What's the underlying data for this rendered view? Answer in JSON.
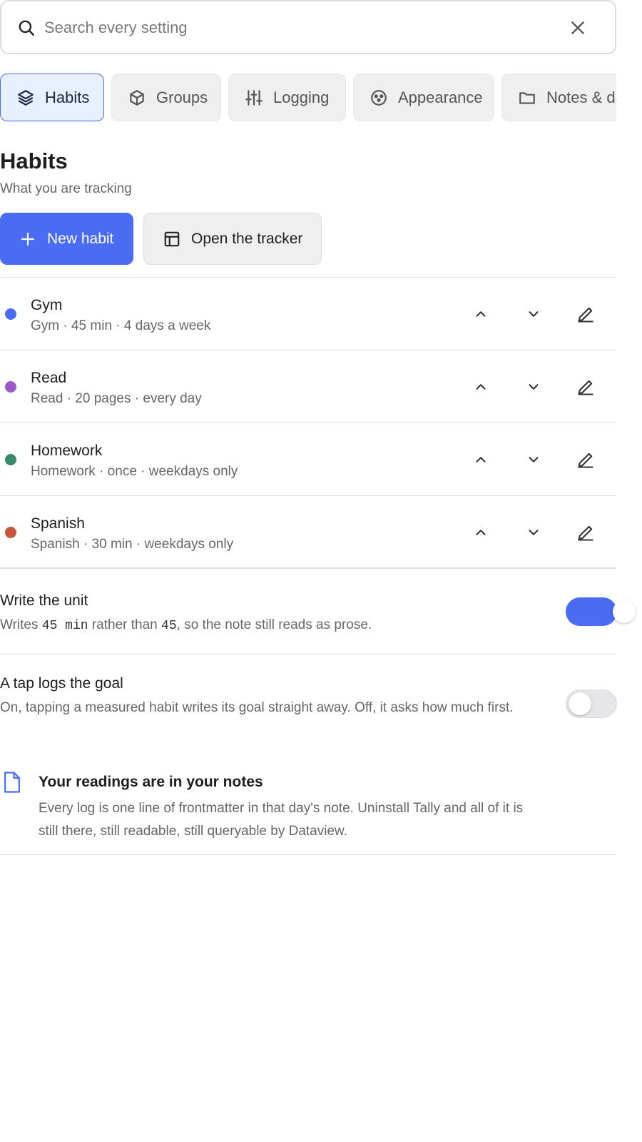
{
  "search": {
    "placeholder": "Search every setting"
  },
  "tabs": [
    {
      "label": "Habits",
      "icon": "layers-icon",
      "active": true
    },
    {
      "label": "Groups",
      "icon": "box-icon",
      "active": false
    },
    {
      "label": "Logging",
      "icon": "sliders-icon",
      "active": false
    },
    {
      "label": "Appearance",
      "icon": "palette-icon",
      "active": false
    },
    {
      "label": "Notes & da",
      "icon": "folder-icon",
      "active": false
    }
  ],
  "section": {
    "title": "Habits",
    "subtitle": "What you are tracking"
  },
  "actions": {
    "new_habit": "New habit",
    "open_tracker": "Open the tracker"
  },
  "habits": [
    {
      "name": "Gym",
      "desc": "Gym · 45 min · 4 days a week",
      "color": "#4a6cf2"
    },
    {
      "name": "Read",
      "desc": "Read · 20 pages · every day",
      "color": "#9b59c9"
    },
    {
      "name": "Homework",
      "desc": "Homework · once · weekdays only",
      "color": "#3a8a6a"
    },
    {
      "name": "Spanish",
      "desc": "Spanish · 30 min · weekdays only",
      "color": "#c8573b"
    }
  ],
  "settings": {
    "write_unit": {
      "title": "Write the unit",
      "desc_a": "Writes ",
      "code_a": "45 min",
      "desc_b": " rather than ",
      "code_b": "45",
      "desc_c": ", so the note still reads as prose.",
      "on": true
    },
    "tap_logs": {
      "title": "A tap logs the goal",
      "desc": "On, tapping a measured habit writes its goal straight away. Off, it asks how much first.",
      "on": false
    }
  },
  "info": {
    "title": "Your readings are in your notes",
    "body": "Every log is one line of frontmatter in that day's note. Uninstall Tally and all of it is still there, still readable, still queryable by Dataview."
  },
  "colors": {
    "accent": "#4a6cf2"
  }
}
